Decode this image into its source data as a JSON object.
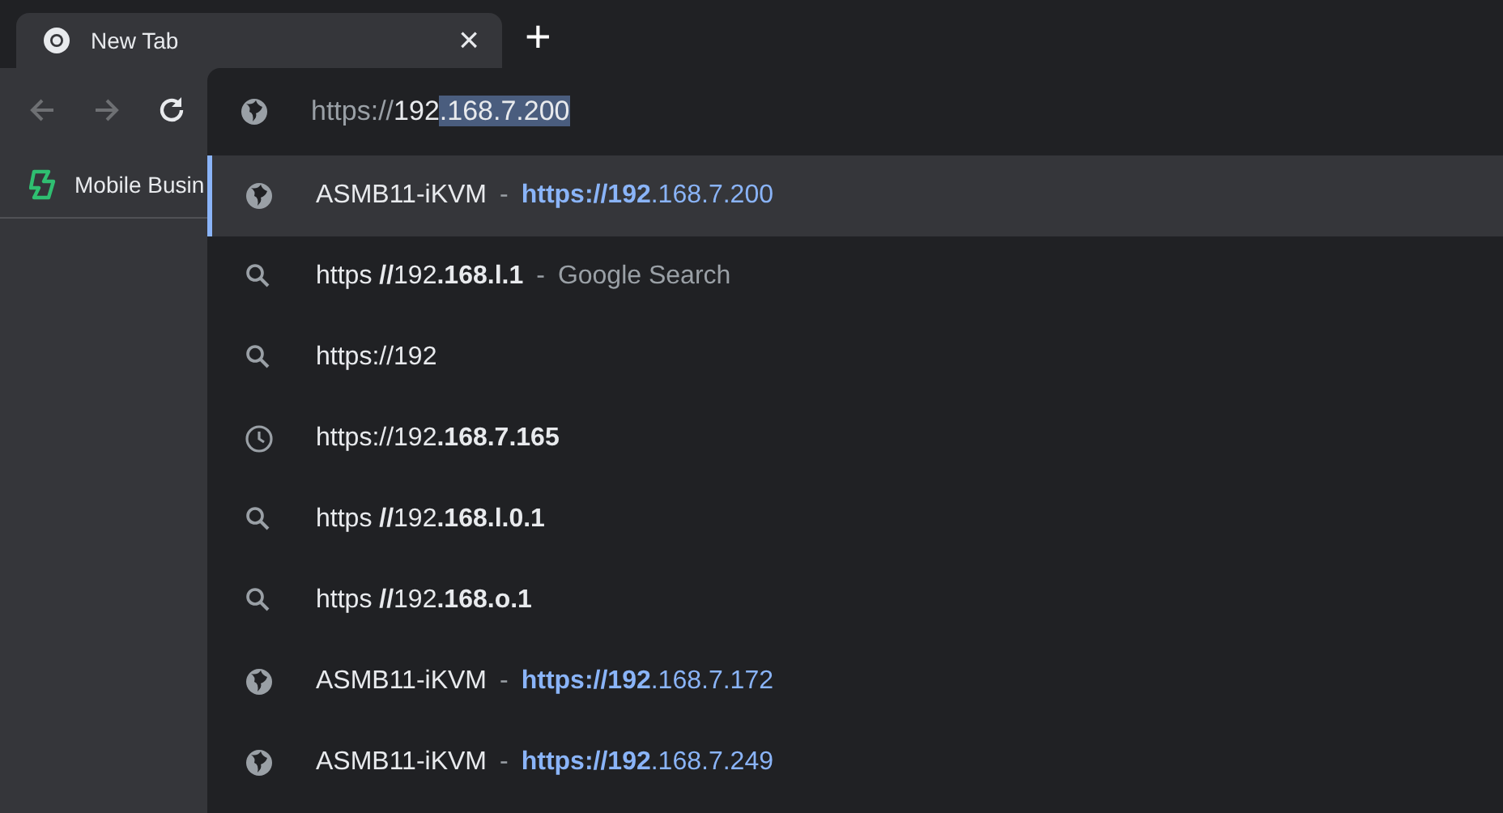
{
  "tab": {
    "title": "New Tab",
    "close": "×",
    "new_tab": "+"
  },
  "bookmarks": [
    {
      "label": "Mobile Busin"
    }
  ],
  "omnibox": {
    "scheme": "https://",
    "typed": "192",
    "selected_text": ".168.7.200"
  },
  "suggestions": [
    {
      "kind": "site",
      "title": "ASMB11-iKVM",
      "separator": "-",
      "url": "**https://192**.168.7.200",
      "selected": true
    },
    {
      "kind": "search",
      "text": "https **//**192**.168.l.1**",
      "separator": "-",
      "suffix": "Google Search",
      "selected": false
    },
    {
      "kind": "search",
      "text": "https://192",
      "selected": false
    },
    {
      "kind": "history",
      "text": "https://192**.168.7.165**",
      "selected": false
    },
    {
      "kind": "search",
      "text": "https **//**192**.168.l.0.1**",
      "selected": false
    },
    {
      "kind": "search",
      "text": "https **//**192**.168.o.1**",
      "selected": false
    },
    {
      "kind": "site",
      "title": "ASMB11-iKVM",
      "separator": "-",
      "url": "**https://192**.168.7.172",
      "selected": false
    },
    {
      "kind": "site",
      "title": "ASMB11-iKVM",
      "separator": "-",
      "url": "**https://192**.168.7.249",
      "selected": false
    }
  ]
}
